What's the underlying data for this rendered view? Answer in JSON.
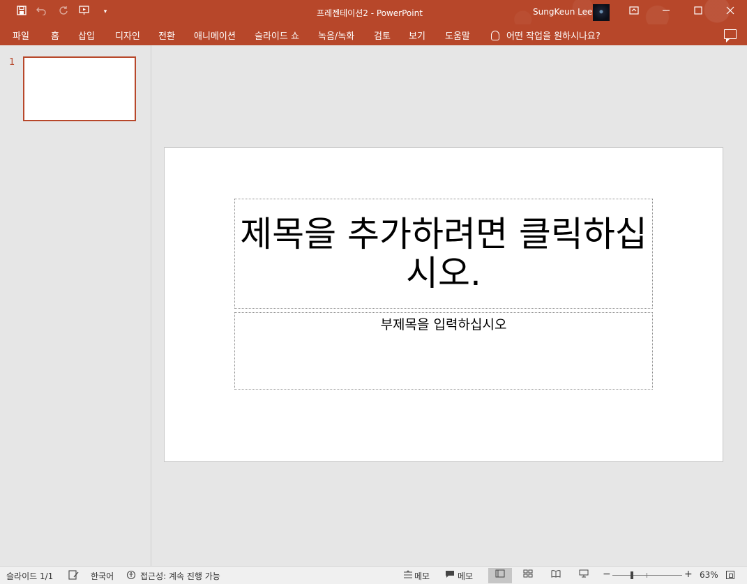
{
  "window": {
    "title": "프레젠테이션2  -  PowerPoint",
    "user_name": "SungKeun Lee"
  },
  "qat": {
    "save_icon": "save-icon",
    "undo_icon": "undo-icon",
    "redo_icon": "redo-icon",
    "present_icon": "start-from-beginning-icon",
    "customize_icon": "chevron-down-icon"
  },
  "ribbon": {
    "tabs": [
      "파일",
      "홈",
      "삽입",
      "디자인",
      "전환",
      "애니메이션",
      "슬라이드 쇼",
      "녹음/녹화",
      "검토",
      "보기",
      "도움말"
    ],
    "tell_me": "어떤 작업을 원하시나요?"
  },
  "thumbnails": [
    {
      "number": "1"
    }
  ],
  "slide": {
    "title_placeholder": "제목을 추가하려면 클릭하십시오.",
    "subtitle_placeholder": "부제목을 입력하십시오"
  },
  "status": {
    "slide_counter": "슬라이드 1/1",
    "language": "한국어",
    "accessibility": "접근성: 계속 진행 가능",
    "notes": "메모",
    "comments": "메모",
    "zoom_minus": "−",
    "zoom_plus": "+",
    "zoom_level": "63%"
  },
  "colors": {
    "accent": "#b7472a",
    "canvas": "#e6e6e6",
    "slide": "#ffffff"
  }
}
